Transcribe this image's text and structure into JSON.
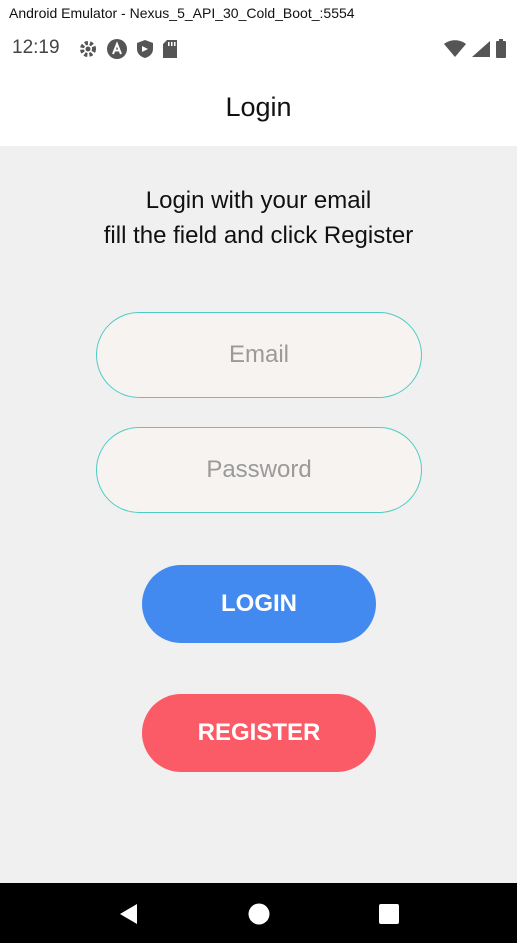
{
  "window": {
    "title": "Android Emulator - Nexus_5_API_30_Cold_Boot_:5554"
  },
  "status_bar": {
    "time": "12:19",
    "left_icons": [
      "gear-icon",
      "android-a-icon",
      "shield-icon",
      "sd-card-icon"
    ],
    "right_icons": [
      "wifi-icon",
      "cellular-signal-icon",
      "battery-icon"
    ]
  },
  "app_bar": {
    "title": "Login"
  },
  "form": {
    "instructions_line1": "Login with your email",
    "instructions_line2": "fill the field and click Register",
    "email": {
      "placeholder": "Email",
      "value": ""
    },
    "password": {
      "placeholder": "Password",
      "value": ""
    },
    "login_label": "LOGIN",
    "register_label": "REGISTER"
  },
  "colors": {
    "field_border": "#4ecdc4",
    "field_background": "#f6f3f1",
    "login_button": "#428aef",
    "register_button": "#fb5b67",
    "nav_bar": "#000000"
  },
  "nav_bar": {
    "buttons": [
      "back-icon",
      "home-icon",
      "recents-icon"
    ]
  }
}
